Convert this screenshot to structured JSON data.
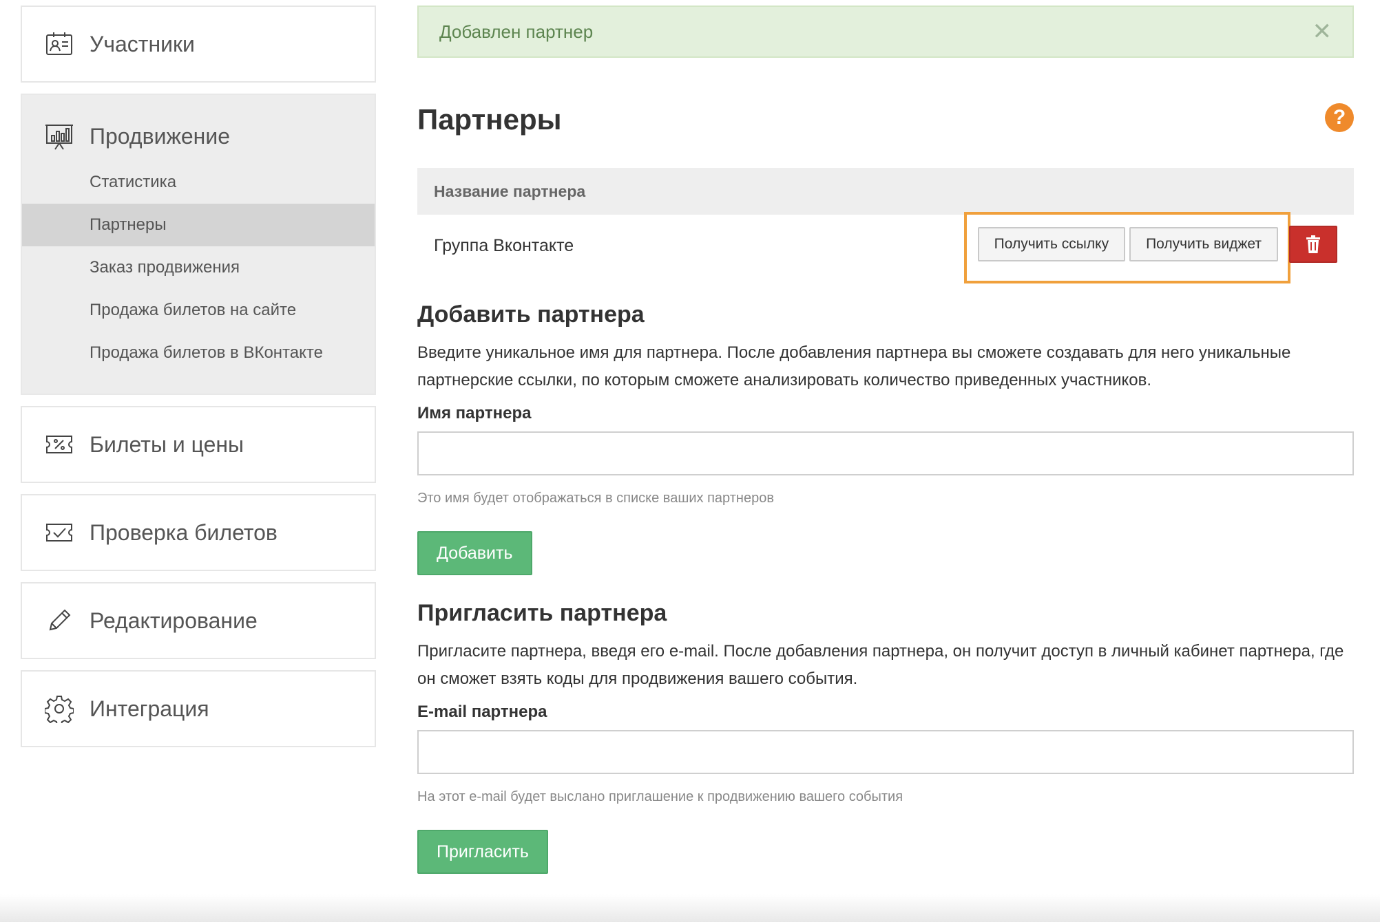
{
  "sidebar": {
    "participants": {
      "label": "Участники",
      "icon": "contacts-icon"
    },
    "promotion": {
      "label": "Продвижение",
      "icon": "presentation-chart-icon",
      "items": [
        {
          "label": "Статистика"
        },
        {
          "label": "Партнеры",
          "active": true
        },
        {
          "label": "Заказ продвижения"
        },
        {
          "label": "Продажа билетов на сайте"
        },
        {
          "label": "Продажа билетов в ВКонтакте"
        }
      ]
    },
    "tickets": {
      "label": "Билеты и цены",
      "icon": "ticket-percent-icon"
    },
    "check": {
      "label": "Проверка билетов",
      "icon": "ticket-check-icon"
    },
    "edit": {
      "label": "Редактирование",
      "icon": "pencil-icon"
    },
    "integration": {
      "label": "Интеграция",
      "icon": "gear-icon"
    }
  },
  "alert": {
    "text": "Добавлен партнер",
    "close": "✕"
  },
  "page": {
    "title": "Партнеры",
    "help": "?"
  },
  "table": {
    "header": "Название партнера",
    "rows": [
      {
        "name": "Группа Вконтакте",
        "link_button": "Получить ссылку",
        "widget_button": "Получить виджет"
      }
    ]
  },
  "add_partner": {
    "title": "Добавить партнера",
    "description": "Введите уникальное имя для партнера. После добавления партнера вы сможете создавать для него уникальные партнерские ссылки, по которым сможете анализировать количество приведенных участников.",
    "field_label": "Имя партнера",
    "value": "",
    "hint": "Это имя будет отображаться в списке ваших партнеров",
    "button": "Добавить"
  },
  "invite_partner": {
    "title": "Пригласить партнера",
    "description": "Пригласите партнера, введя его e-mail. После добавления партнера, он получит доступ в личный кабинет партнера, где он сможет взять коды для продвижения вашего события.",
    "field_label": "E-mail партнера",
    "value": "",
    "hint": "На этот e-mail будет выслано приглашение к продвижению вашего события",
    "button": "Пригласить"
  },
  "colors": {
    "accent_green": "#5cb878",
    "danger_red": "#c9302c",
    "highlight_orange": "#f0a03c",
    "help_orange": "#ef8a2b",
    "alert_bg": "#e3f0dc"
  }
}
